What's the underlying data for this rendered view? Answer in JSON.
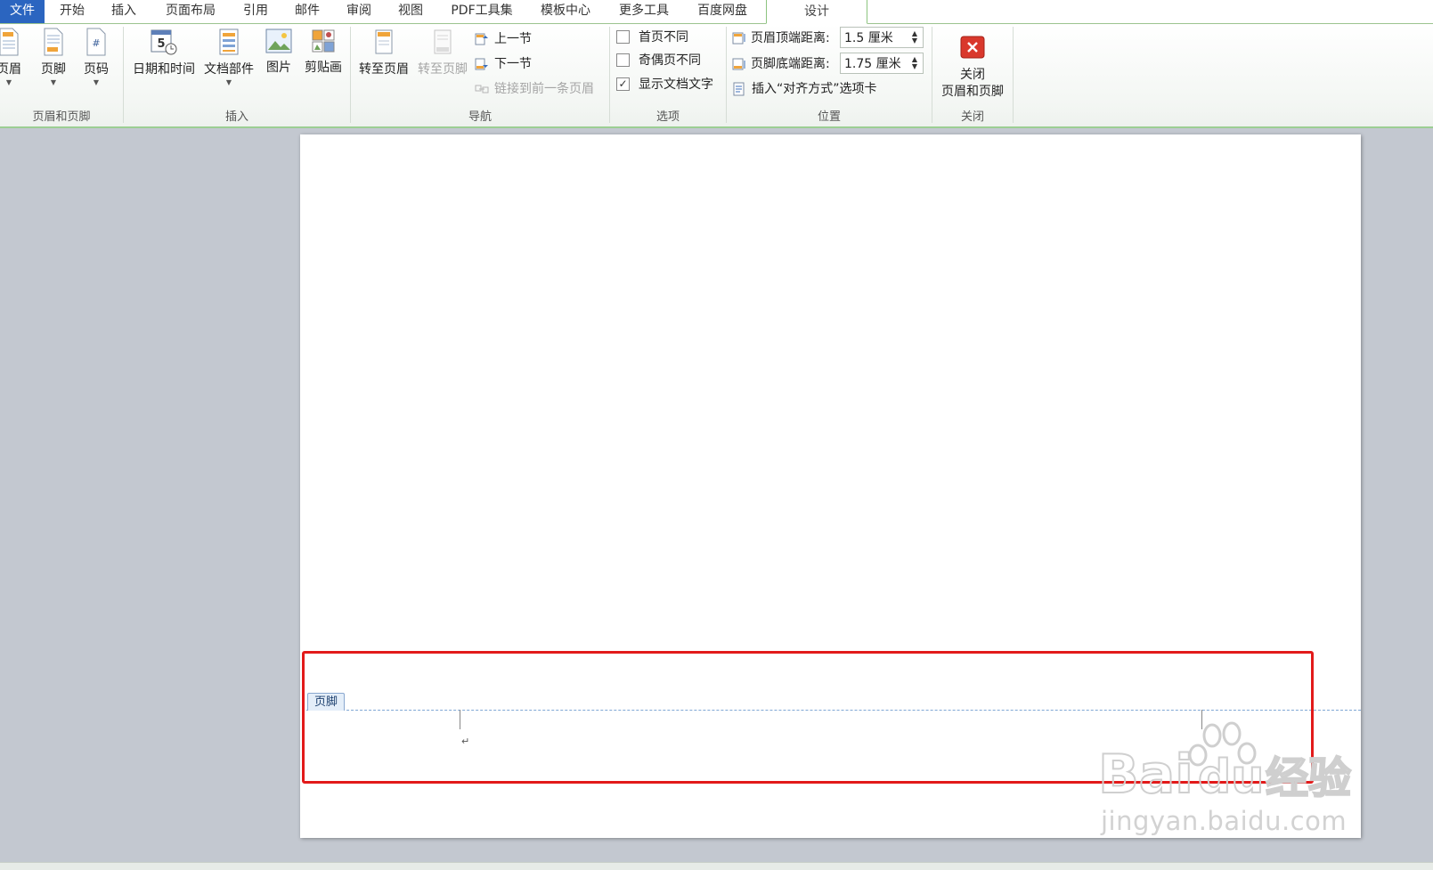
{
  "tabs": [
    {
      "label": "文件",
      "key": "file"
    },
    {
      "label": "开始",
      "key": "home"
    },
    {
      "label": "插入",
      "key": "insert"
    },
    {
      "label": "页面布局",
      "key": "layout"
    },
    {
      "label": "引用",
      "key": "references"
    },
    {
      "label": "邮件",
      "key": "mail"
    },
    {
      "label": "审阅",
      "key": "review"
    },
    {
      "label": "视图",
      "key": "view"
    },
    {
      "label": "PDF工具集",
      "key": "pdf"
    },
    {
      "label": "模板中心",
      "key": "templates"
    },
    {
      "label": "更多工具",
      "key": "more"
    },
    {
      "label": "百度网盘",
      "key": "baidu"
    },
    {
      "label": "设计",
      "key": "design"
    }
  ],
  "groups": {
    "header_footer": {
      "label": "页眉和页脚",
      "header_btn": "页眉",
      "footer_btn": "页脚",
      "pagenum_btn": "页码"
    },
    "insert": {
      "label": "插入",
      "datetime_btn": "日期和时间",
      "docparts_btn": "文档部件",
      "picture_btn": "图片",
      "clipart_btn": "剪贴画"
    },
    "navigation": {
      "label": "导航",
      "goto_header": "转至页眉",
      "goto_footer": "转至页脚",
      "prev_section": "上一节",
      "next_section": "下一节",
      "link_prev": "链接到前一条页眉"
    },
    "options": {
      "label": "选项",
      "first_page_diff": {
        "label": "首页不同",
        "checked": false
      },
      "odd_even_diff": {
        "label": "奇偶页不同",
        "checked": false
      },
      "show_doc_text": {
        "label": "显示文档文字",
        "checked": true
      }
    },
    "position": {
      "label": "位置",
      "header_top_label": "页眉顶端距离:",
      "header_top_value": "1.5 厘米",
      "footer_bottom_label": "页脚底端距离:",
      "footer_bottom_value": "1.75 厘米",
      "insert_align_tab": "插入“对齐方式”选项卡"
    },
    "close": {
      "label": "关闭",
      "close_btn_line1": "关闭",
      "close_btn_line2": "页眉和页脚"
    }
  },
  "document": {
    "footer_tag": "页脚",
    "paragraph_mark": "↵"
  },
  "watermark": {
    "brand": "Bai",
    "brand2": "du",
    "brand_cn": "经验",
    "url": "jingyan.baidu.com"
  },
  "colors": {
    "file_tab": "#2b65c0",
    "accent_green": "#9ccf93",
    "highlight_red": "#e21a1a",
    "footer_dash": "#7fa7d4"
  }
}
